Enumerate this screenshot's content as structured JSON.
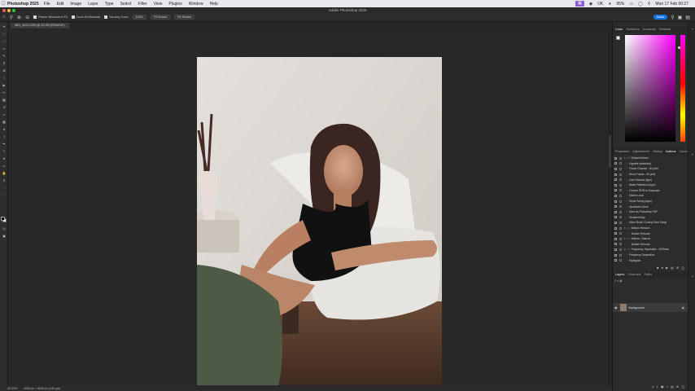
{
  "menubar": {
    "app_name": "Photoshop 2025",
    "items": [
      "File",
      "Edit",
      "Image",
      "Layer",
      "Type",
      "Select",
      "Filter",
      "View",
      "Plugins",
      "Window",
      "Help"
    ],
    "status_percent": "95%",
    "input_source": "UK",
    "clock": "Mon 17 Feb 00:27"
  },
  "window": {
    "title": "Adobe Photoshop 2025"
  },
  "options_bar": {
    "resize_windows": "Resize Windows to Fit",
    "zoom_all": "Zoom All Windows",
    "scrubby_zoom": "Scrubby Zoom",
    "zoom_100": "100%",
    "fit_screen": "Fit Screen",
    "fill_screen": "Fill Screen",
    "share": "Share"
  },
  "document": {
    "tab_label": "IMG_5424.CR3 @ 33.3% (RGB/16*)",
    "zoom": "33.33%",
    "dimensions": "4000 px × 6000 px (240 ppi)"
  },
  "color_panel": {
    "tabs": [
      "Color",
      "Swatches",
      "Gradients",
      "Patterns"
    ],
    "active": "Color"
  },
  "actions_panel": {
    "tabs": [
      "Properties",
      "Adjustments",
      "History",
      "Actions",
      "Comments"
    ],
    "active": "Actions",
    "items": [
      {
        "label": "Default Actions",
        "folder": true,
        "expanded": true,
        "indent": 0
      },
      {
        "label": "Vignette (selection)",
        "indent": 1
      },
      {
        "label": "Frame Channel - 50 pixel",
        "indent": 1
      },
      {
        "label": "Wood Frame - 50 pixel",
        "indent": 1
      },
      {
        "label": "Cast Shadow (type)",
        "indent": 1
      },
      {
        "label": "Water Reflection (type)",
        "indent": 1
      },
      {
        "label": "Custom RGB to Grayscale",
        "indent": 1
      },
      {
        "label": "Molten Lead",
        "indent": 1
      },
      {
        "label": "Sepia Toning (layer)",
        "indent": 1
      },
      {
        "label": "Quadrant Colors",
        "indent": 1
      },
      {
        "label": "Save As Photoshop PDF",
        "indent": 1
      },
      {
        "label": "Gradient Map",
        "indent": 1
      },
      {
        "label": "Mixer Brush Cloning Paint Setup",
        "indent": 1
      },
      {
        "label": "Bottom Retouch",
        "folder": true,
        "expanded": true,
        "indent": 0
      },
      {
        "label": "Bottom Retouch",
        "indent": 2
      },
      {
        "label": "Bottom - Natural",
        "folder": true,
        "expanded": true,
        "indent": 0
      },
      {
        "label": "Bottom Retouch",
        "indent": 2
      },
      {
        "label": "Frequency Separation - AVRetou",
        "folder": true,
        "expanded": true,
        "indent": 0
      },
      {
        "label": "Frequency Separation",
        "indent": 1
      },
      {
        "label": "Highlights",
        "indent": 1
      }
    ]
  },
  "layers_panel": {
    "tabs": [
      "Layers",
      "Channels",
      "Paths"
    ],
    "active": "Layers",
    "layer_name": "Background"
  }
}
